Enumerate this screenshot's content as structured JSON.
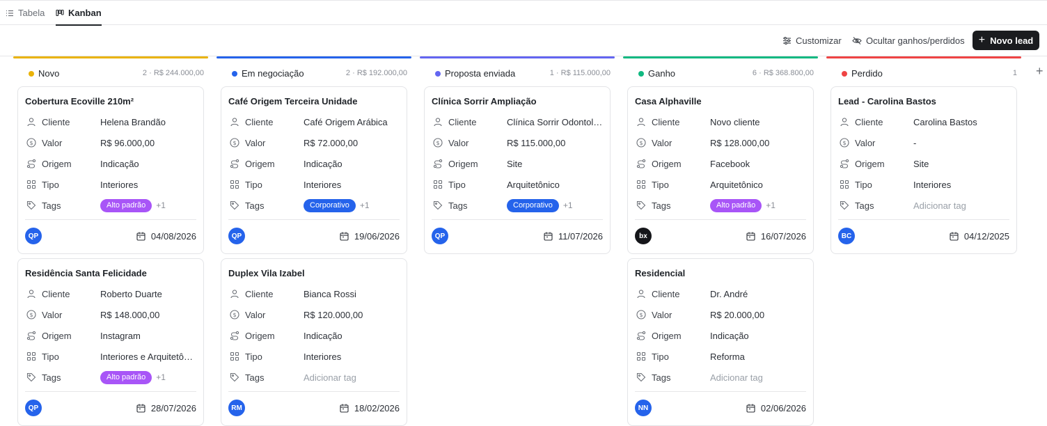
{
  "tabs": [
    {
      "label": "Tabela",
      "icon": "list-icon"
    },
    {
      "label": "Kanban",
      "icon": "kanban-icon"
    }
  ],
  "toolbar": {
    "customize_label": "Customizar",
    "hide_label": "Ocultar ganhos/perdidos",
    "new_lead_label": "Novo lead"
  },
  "field_labels": {
    "client": "Cliente",
    "value": "Valor",
    "origin": "Origem",
    "type": "Tipo",
    "tags": "Tags"
  },
  "columns": [
    {
      "title": "Novo",
      "meta": "2 · R$ 244.000,00",
      "color": "#eab308",
      "cards": [
        {
          "title": "Cobertura Ecoville 210m²",
          "client": "Helena Brandão",
          "value": "R$ 96.000,00",
          "origin": "Indicação",
          "type": "Interiores",
          "tag": "Alto padrão",
          "tag_color": "#a855f7",
          "tag_more": "+1",
          "avatar": "QP",
          "date": "04/08/2026"
        },
        {
          "title": "Residência Santa Felicidade",
          "client": "Roberto Duarte",
          "value": "R$ 148.000,00",
          "origin": "Instagram",
          "type": "Interiores e Arquitetônico",
          "tag": "Alto padrão",
          "tag_color": "#a855f7",
          "tag_more": "+1",
          "avatar": "QP",
          "date": "28/07/2026"
        }
      ]
    },
    {
      "title": "Em negociação",
      "meta": "2 · R$ 192.000,00",
      "color": "#2563eb",
      "cards": [
        {
          "title": "Café Origem Terceira Unidade",
          "client": "Café Origem Arábica",
          "value": "R$ 72.000,00",
          "origin": "Indicação",
          "type": "Interiores",
          "tag": "Corporativo",
          "tag_color": "#2563eb",
          "tag_more": "+1",
          "avatar": "QP",
          "date": "19/06/2026"
        },
        {
          "title": "Duplex Vila Izabel",
          "client": "Bianca Rossi",
          "value": "R$ 120.000,00",
          "origin": "Indicação",
          "type": "Interiores",
          "tag_placeholder": "Adicionar tag",
          "avatar": "RM",
          "date": "18/02/2026"
        }
      ]
    },
    {
      "title": "Proposta enviada",
      "meta": "1 · R$ 115.000,00",
      "color": "#6366f1",
      "cards": [
        {
          "title": "Clínica Sorrir Ampliação",
          "client": "Clínica Sorrir Odontologia",
          "value": "R$ 115.000,00",
          "origin": "Site",
          "type": "Arquitetônico",
          "tag": "Corporativo",
          "tag_color": "#2563eb",
          "tag_more": "+1",
          "avatar": "QP",
          "date": "11/07/2026"
        }
      ]
    },
    {
      "title": "Ganho",
      "meta": "6 · R$ 368.800,00",
      "color": "#10b981",
      "cards": [
        {
          "title": "Casa Alphaville",
          "client": "Novo cliente",
          "value": "R$ 128.000,00",
          "origin": "Facebook",
          "type": "Arquitetônico",
          "tag": "Alto padrão",
          "tag_color": "#a855f7",
          "tag_more": "+1",
          "avatar": "bx",
          "avatar_dark": true,
          "date": "16/07/2026"
        },
        {
          "title": "Residencial",
          "client": "Dr. André",
          "value": "R$ 20.000,00",
          "origin": "Indicação",
          "type": "Reforma",
          "tag_placeholder": "Adicionar tag",
          "avatar": "NN",
          "date": "02/06/2026"
        }
      ]
    },
    {
      "title": "Perdido",
      "meta": "1",
      "color": "#ef4444",
      "cards": [
        {
          "title": "Lead - Carolina Bastos",
          "client": "Carolina Bastos",
          "value": "-",
          "origin": "Site",
          "type": "Interiores",
          "tag_placeholder": "Adicionar tag",
          "avatar": "BC",
          "date": "04/12/2025"
        }
      ]
    }
  ],
  "add_column_label": "+"
}
